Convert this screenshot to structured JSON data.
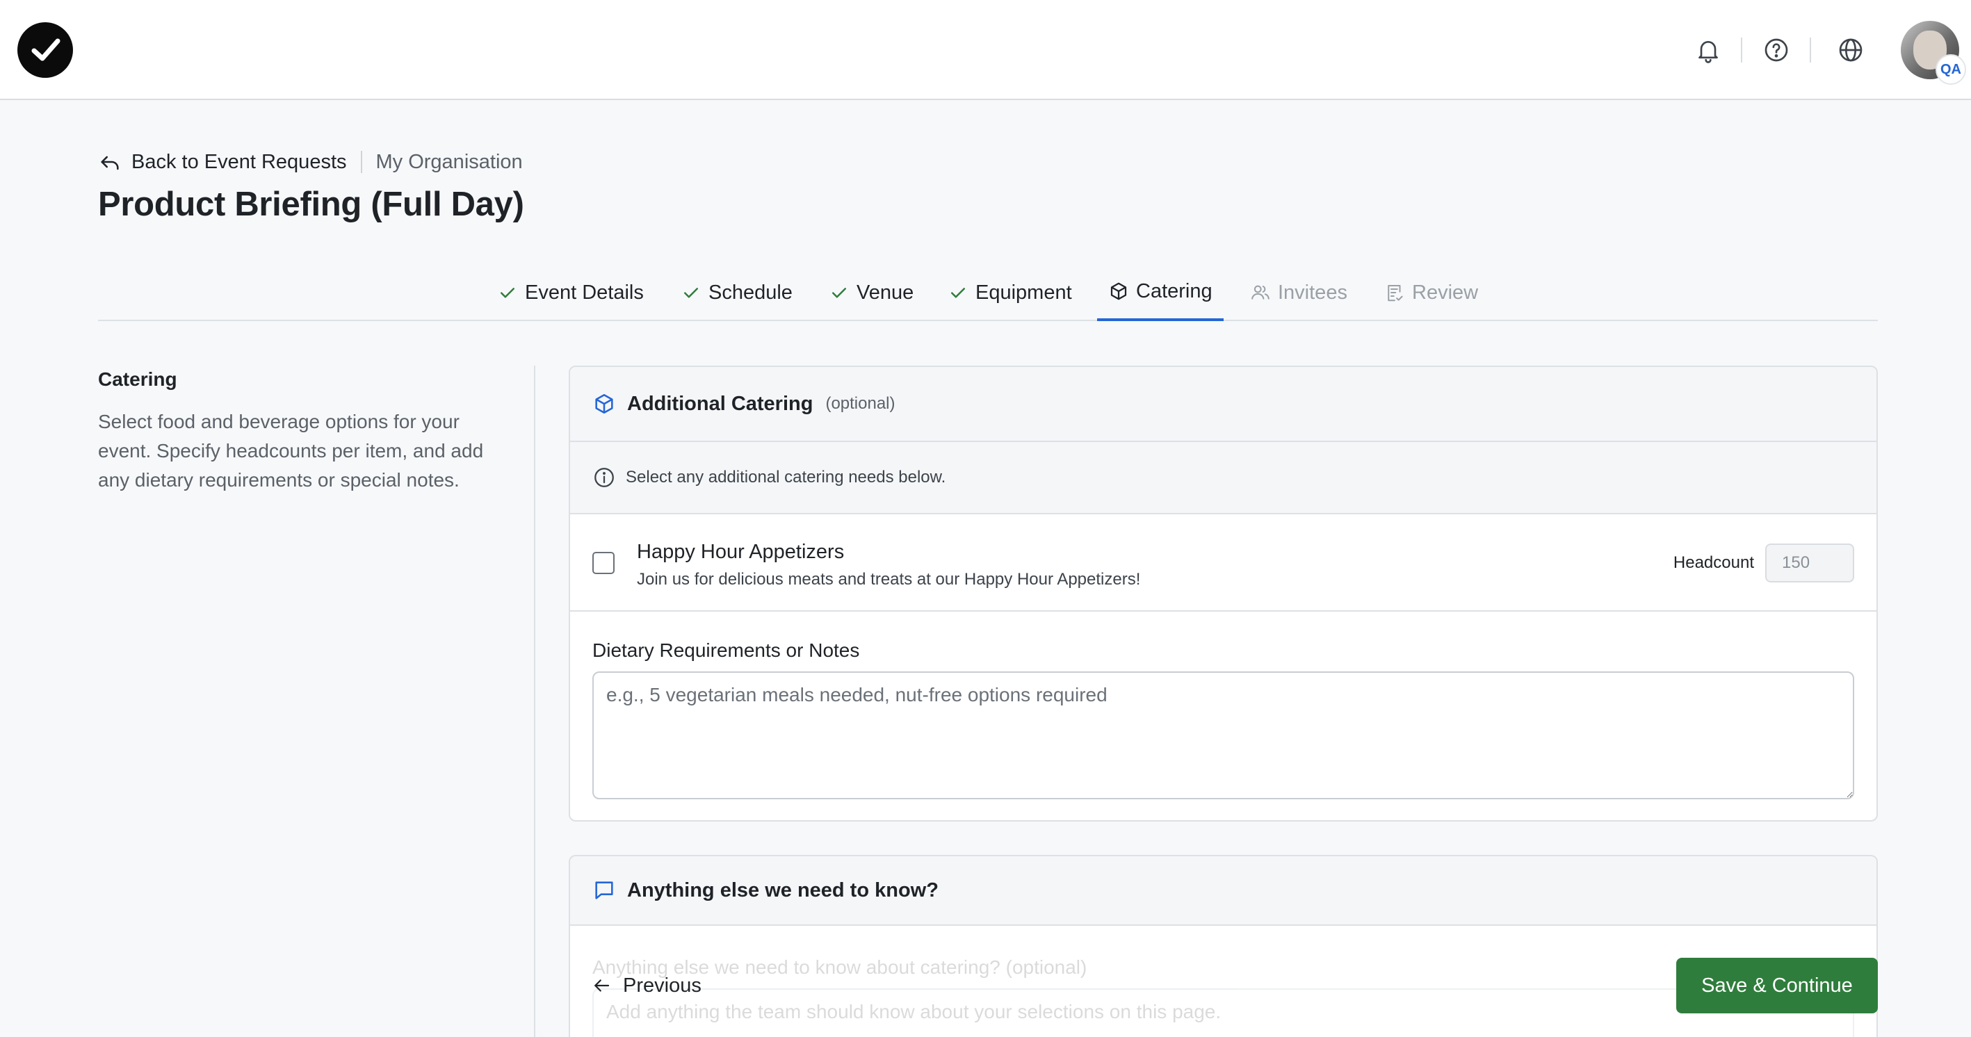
{
  "header": {
    "icons": [
      "bell-icon",
      "help-circle-icon",
      "globe-icon"
    ],
    "avatar_badge": "QA"
  },
  "breadcrumb": {
    "back_label": "Back to Event Requests",
    "organisation": "My Organisation"
  },
  "page_title": "Product Briefing (Full Day)",
  "tabs": [
    {
      "label": "Event Details",
      "state": "complete",
      "icon": "check-icon"
    },
    {
      "label": "Schedule",
      "state": "complete",
      "icon": "check-icon"
    },
    {
      "label": "Venue",
      "state": "complete",
      "icon": "check-icon"
    },
    {
      "label": "Equipment",
      "state": "complete",
      "icon": "check-icon"
    },
    {
      "label": "Catering",
      "state": "active",
      "icon": "box-icon"
    },
    {
      "label": "Invitees",
      "state": "disabled",
      "icon": "users-icon"
    },
    {
      "label": "Review",
      "state": "disabled",
      "icon": "clipboard-icon"
    }
  ],
  "sidebar": {
    "title": "Catering",
    "description": "Select food and beverage options for your event. Specify headcounts per item, and add any dietary requirements or special notes."
  },
  "catering_card": {
    "title": "Additional Catering",
    "optional_tag": "(optional)",
    "info_text": "Select any additional catering needs below.",
    "items": [
      {
        "name": "Happy Hour Appetizers",
        "description": "Join us for delicious meats and treats at our Happy Hour Appetizers!",
        "checked": false,
        "headcount_label": "Headcount",
        "headcount_value": "150"
      }
    ],
    "notes_label": "Dietary Requirements or Notes",
    "notes_placeholder": "e.g., 5 vegetarian meals needed, nut-free options required",
    "notes_value": ""
  },
  "extra_card": {
    "title": "Anything else we need to know?",
    "field_label": "Anything else we need to know about catering? (optional)",
    "field_placeholder": "Add anything the team should know about your selections on this page."
  },
  "actions": {
    "previous_label": "Previous",
    "save_label": "Save & Continue"
  },
  "colors": {
    "accent": "#2466d6",
    "complete": "#2f7d3c",
    "primary_button": "#2f7d3c"
  }
}
